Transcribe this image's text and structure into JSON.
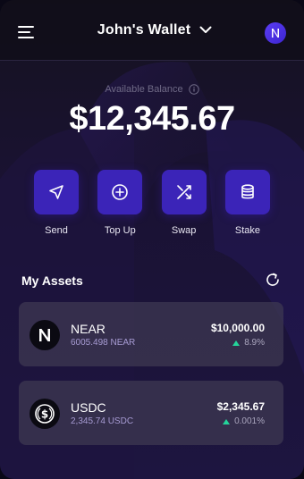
{
  "header": {
    "wallet_name": "John's Wallet"
  },
  "balance": {
    "label": "Available Balance",
    "amount": "$12,345.67"
  },
  "actions": [
    {
      "label": "Send",
      "icon": "send-icon"
    },
    {
      "label": "Top Up",
      "icon": "plus-circle-icon"
    },
    {
      "label": "Swap",
      "icon": "shuffle-icon"
    },
    {
      "label": "Stake",
      "icon": "database-icon"
    }
  ],
  "assets": {
    "title": "My Assets",
    "items": [
      {
        "name": "NEAR",
        "amount": "6005.498 NEAR",
        "value": "$10,000.00",
        "change": "8.9%",
        "icon": "near-logo-icon"
      },
      {
        "name": "USDC",
        "amount": "2,345.74 USDC",
        "value": "$2,345.67",
        "change": "0.001%",
        "icon": "usdc-logo-icon"
      }
    ]
  },
  "colors": {
    "accent": "#3b24b8",
    "positive": "#24d49a",
    "background": "#1a1233"
  }
}
